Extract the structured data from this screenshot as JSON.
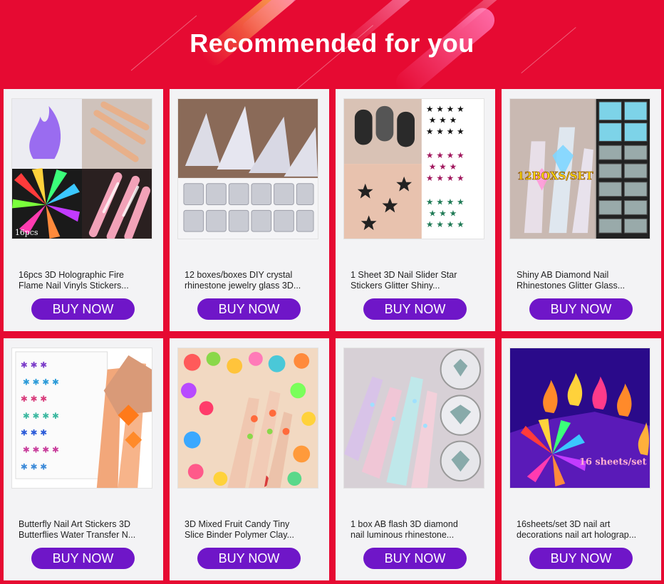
{
  "header": {
    "title": "Recommended for you"
  },
  "products": [
    {
      "line1": "16pcs 3D Holographic Fire",
      "line2": "Flame Nail Vinyls Stickers...",
      "button": "BUY NOW",
      "image_caption": "16pcs"
    },
    {
      "line1": "12 boxes/boxes DIY crystal",
      "line2": "rhinestone jewelry glass 3D...",
      "button": "BUY NOW",
      "image_caption": ""
    },
    {
      "line1": "1 Sheet 3D Nail Slider Star",
      "line2": "Stickers Glitter Shiny...",
      "button": "BUY NOW",
      "image_caption": ""
    },
    {
      "line1": "Shiny AB Diamond Nail",
      "line2": "Rhinestones Glitter Glass...",
      "button": "BUY NOW",
      "image_caption": "12BOXS/SET"
    },
    {
      "line1": "Butterfly Nail Art Stickers 3D",
      "line2": "Butterflies Water Transfer N...",
      "button": "BUY NOW",
      "image_caption": ""
    },
    {
      "line1": "3D Mixed Fruit Candy Tiny",
      "line2": "Slice Binder Polymer Clay...",
      "button": "BUY NOW",
      "image_caption": ""
    },
    {
      "line1": "1 box AB flash 3D diamond",
      "line2": "nail luminous rhinestone...",
      "button": "BUY NOW",
      "image_caption": ""
    },
    {
      "line1": "16sheets/set 3D nail art",
      "line2": "decorations nail art holograp...",
      "button": "BUY NOW",
      "image_caption": "16 sheets/set"
    }
  ],
  "colors": {
    "background": "#e60a32",
    "card": "#f3f3f5",
    "button": "#6f16c8"
  }
}
